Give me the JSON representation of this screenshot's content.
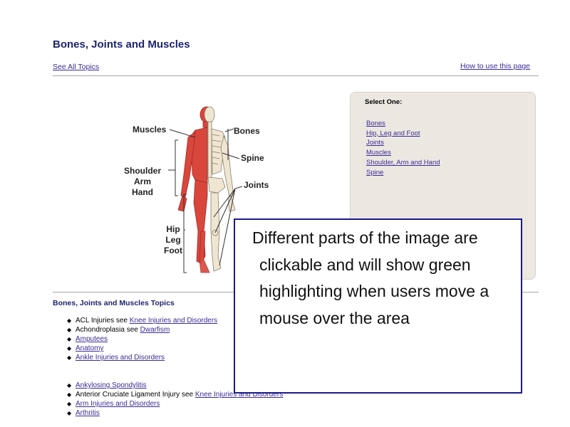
{
  "page": {
    "title": "Bones, Joints and Muscles",
    "see_all": "See All Topics",
    "how_to": "How to use this page"
  },
  "figure": {
    "labels": {
      "muscles": "Muscles",
      "bones": "Bones",
      "spine": "Spine",
      "shoulder_arm_hand": "Shoulder\nArm\nHand",
      "joints": "Joints",
      "hip_leg_foot": "Hip\nLeg\nFoot"
    },
    "colors": {
      "muscle": "#d9463c",
      "bone": "#efe6d2",
      "label": "#222222"
    }
  },
  "select_panel": {
    "heading": "Select One:",
    "items": [
      "Bones",
      "Hip, Leg and Foot",
      "Joints",
      "Muscles",
      "Shoulder, Arm and Hand",
      "Spine"
    ]
  },
  "topics": {
    "title": "Bones, Joints and Muscles Topics",
    "group1": [
      {
        "prefix": "ACL Injuries see ",
        "link": "Knee Injuries and Disorders"
      },
      {
        "prefix": "Achondroplasia see ",
        "link": "Dwarfism"
      },
      {
        "prefix": "",
        "link": "Amputees"
      },
      {
        "prefix": "",
        "link": "Anatomy"
      },
      {
        "prefix": "",
        "link": "Ankle Injuries and Disorders"
      }
    ],
    "group2": [
      {
        "prefix": "",
        "link": "Ankylosing Spondylitis"
      },
      {
        "prefix": "Anterior Cruciate Ligament Injury see ",
        "link": "Knee Injuries and Disorders"
      },
      {
        "prefix": "",
        "link": "Arm Injuries and Disorders"
      },
      {
        "prefix": "",
        "link": "Arthritis"
      }
    ]
  },
  "callout": {
    "text": "Different parts of the image are clickable and will show green highlighting when users move a mouse over the area",
    "border_color": "#1a1a8a"
  }
}
